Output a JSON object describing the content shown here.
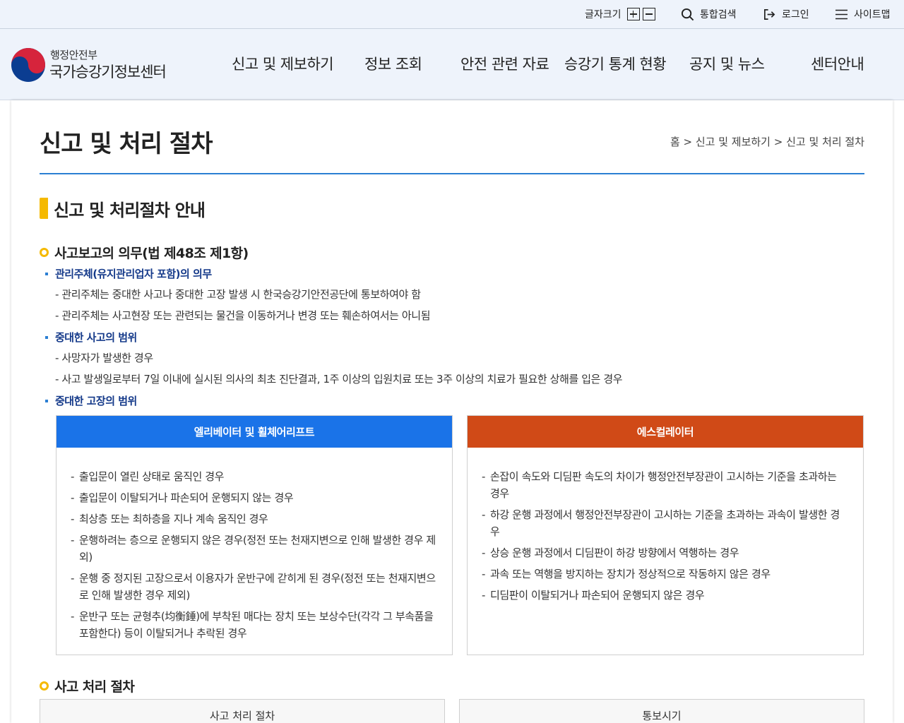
{
  "util": {
    "font_size_label": "글자크기",
    "search_label": "통합검색",
    "login_label": "로그인",
    "sitemap_label": "사이트맵"
  },
  "logo": {
    "ministry": "행정안전부",
    "center": "국가승강기정보센터"
  },
  "gnb": [
    "신고 및 제보하기",
    "정보 조회",
    "안전 관련 자료",
    "승강기 통계 현황",
    "공지 및 뉴스",
    "센터안내"
  ],
  "page": {
    "title": "신고 및 처리 절차",
    "breadcrumb": "홈 > 신고 및 제보하기 > 신고 및 처리 절차"
  },
  "section": {
    "title": "신고 및 처리절차 안내",
    "duty": {
      "title": "사고보고의 의무(법 제48조 제1항)",
      "owner": {
        "title": "관리주체(유지관리업자 포함)의 의무",
        "items": [
          "- 관리주체는 중대한 사고나 중대한 고장 발생 시 한국승강기안전공단에 통보하여야 함",
          "- 관리주체는 사고현장 또는 관련되는 물건을 이동하거나 변경 또는 훼손하여서는 아니됨"
        ]
      },
      "accident": {
        "title": "중대한 사고의 범위",
        "items": [
          "- 사망자가 발생한 경우",
          "- 사고 발생일로부터 7일 이내에 실시된 의사의 최초 진단결과, 1주 이상의 입원치료 또는 3주 이상의 치료가 필요한 상해를 입은 경우"
        ]
      },
      "failure": {
        "title": "중대한 고장의 범위",
        "elevator": {
          "title": "엘리베이터 및 휠체어리프트",
          "items": [
            "출입문이 열린 상태로 움직인 경우",
            "출입문이 이탈되거나 파손되어 운행되지 않는 경우",
            "최상층 또는 최하층을 지나 계속 움직인 경우",
            "운행하려는 층으로 운행되지 않은 경우(정전 또는 천재지변으로 인해 발생한 경우 제외)",
            "운행 중 정지된 고장으로서 이용자가 운반구에 갇히게 된 경우(정전 또는 천재지변으로 인해 발생한 경우 제외)",
            "운반구 또는 균형추(均衡錘)에 부착된 매다는 장치 또는 보상수단(각각 그 부속품을 포함한다) 등이 이탈되거나 추락된 경우"
          ]
        },
        "escalator": {
          "title": "에스컬레이터",
          "items": [
            "손잡이 속도와 디딤판 속도의 차이가 행정안전부장관이 고시하는 기준을 초과하는 경우",
            "하강 운행 과정에서 행정안전부장관이 고시하는 기준을 초과하는 과속이 발생한 경우",
            "상승 운행 과정에서 디딤판이 하강 방향에서 역행하는 경우",
            "과속 또는 역행을 방지하는 장치가 정상적으로 작동하지 않은 경우",
            "디딤판이 이탈되거나 파손되어 운행되지 않은 경우"
          ]
        }
      }
    },
    "process": {
      "title": "사고 처리 절차",
      "tabs": [
        "사고 처리 절차",
        "통보시기"
      ]
    }
  }
}
